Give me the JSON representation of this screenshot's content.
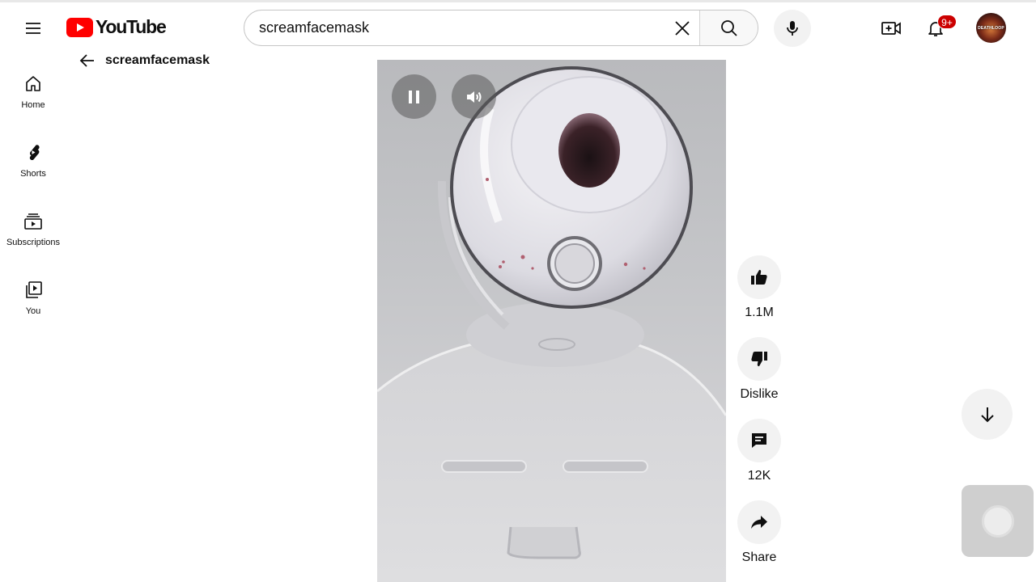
{
  "header": {
    "logo_text": "YouTube",
    "search": {
      "value": "screamfacemask",
      "placeholder": "Search"
    },
    "notification_count": "9+",
    "avatar_text": "DEATHLOOP"
  },
  "page": {
    "back_title": "screamfacemask"
  },
  "sidebar": {
    "items": [
      {
        "label": "Home",
        "icon": "home-icon"
      },
      {
        "label": "Shorts",
        "icon": "shorts-icon"
      },
      {
        "label": "Subscriptions",
        "icon": "subscriptions-icon"
      },
      {
        "label": "You",
        "icon": "you-icon"
      }
    ]
  },
  "player": {
    "state": "playing",
    "controls": [
      "pause-icon",
      "volume-icon"
    ]
  },
  "actions": {
    "like": {
      "label": "1.1M",
      "icon": "thumbs-up-icon"
    },
    "dislike": {
      "label": "Dislike",
      "icon": "thumbs-down-icon"
    },
    "comments": {
      "label": "12K",
      "icon": "comment-icon"
    },
    "share": {
      "label": "Share",
      "icon": "share-icon"
    }
  },
  "colors": {
    "brand_red": "#FF0000",
    "badge_red": "#CC0000",
    "text": "#0F0F0F",
    "chip_bg": "#F2F2F2"
  }
}
